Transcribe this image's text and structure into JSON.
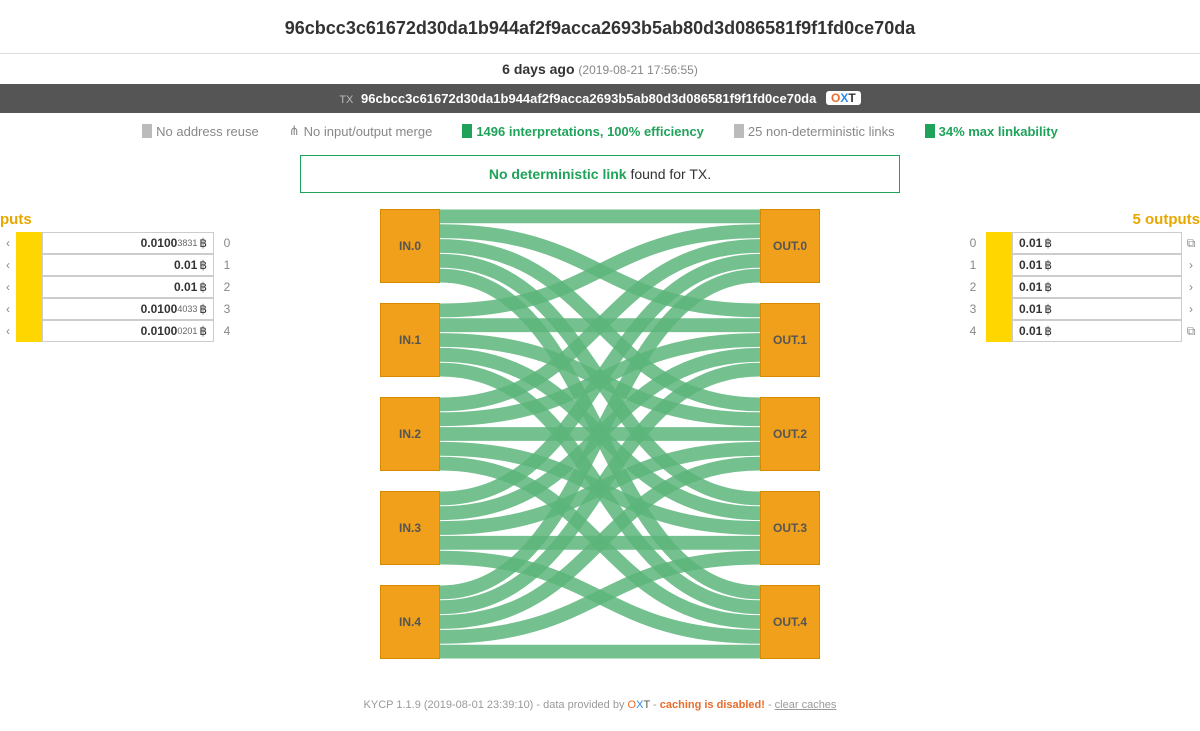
{
  "header": {
    "txid": "96cbcc3c61672d30da1b944af2f9acca2693b5ab80d3d086581f9f1fd0ce70da"
  },
  "time": {
    "ago": "6 days ago",
    "timestamp": "(2019-08-21 17:56:55)"
  },
  "txbar": {
    "label": "TX",
    "txid": "96cbcc3c61672d30da1b944af2f9acca2693b5ab80d3d086581f9f1fd0ce70da",
    "oxt_o": "O",
    "oxt_x": "X",
    "oxt_t": "T"
  },
  "stats": {
    "no_reuse": "No address reuse",
    "no_merge": "No input/output merge",
    "interp": "1496 interpretations, 100% efficiency",
    "nondet": "25 non-deterministic links",
    "maxlink": "34% max linkability"
  },
  "notice": {
    "highlight": "No deterministic link",
    "rest": " found for TX."
  },
  "inputs": {
    "title": "puts",
    "rows": [
      {
        "amt": "0.0100",
        "sub": "3831",
        "idx": "0"
      },
      {
        "amt": "0.01",
        "sub": "",
        "idx": "1"
      },
      {
        "amt": "0.01",
        "sub": "",
        "idx": "2"
      },
      {
        "amt": "0.0100",
        "sub": "4033",
        "idx": "3"
      },
      {
        "amt": "0.0100",
        "sub": "0201",
        "idx": "4"
      }
    ]
  },
  "outputs": {
    "title": "5 outputs",
    "rows": [
      {
        "amt": "0.01",
        "idx": "0",
        "act": "copy"
      },
      {
        "amt": "0.01",
        "idx": "1",
        "act": "chev"
      },
      {
        "amt": "0.01",
        "idx": "2",
        "act": "chev"
      },
      {
        "amt": "0.01",
        "idx": "3",
        "act": "chev"
      },
      {
        "amt": "0.01",
        "idx": "4",
        "act": "copy"
      }
    ]
  },
  "sankey": {
    "in_labels": [
      "IN.0",
      "IN.1",
      "IN.2",
      "IN.3",
      "IN.4"
    ],
    "out_labels": [
      "OUT.0",
      "OUT.1",
      "OUT.2",
      "OUT.3",
      "OUT.4"
    ]
  },
  "footer": {
    "app": "KYCP 1.1.9 (2019-08-01 23:39:10)",
    "provided": " - data provided by ",
    "oxt_o": "O",
    "oxt_x": "X",
    "oxt_t": "T",
    "sep": " - ",
    "warn": "caching is disabled!",
    "clear": "clear caches"
  },
  "btc_symbol": "฿"
}
